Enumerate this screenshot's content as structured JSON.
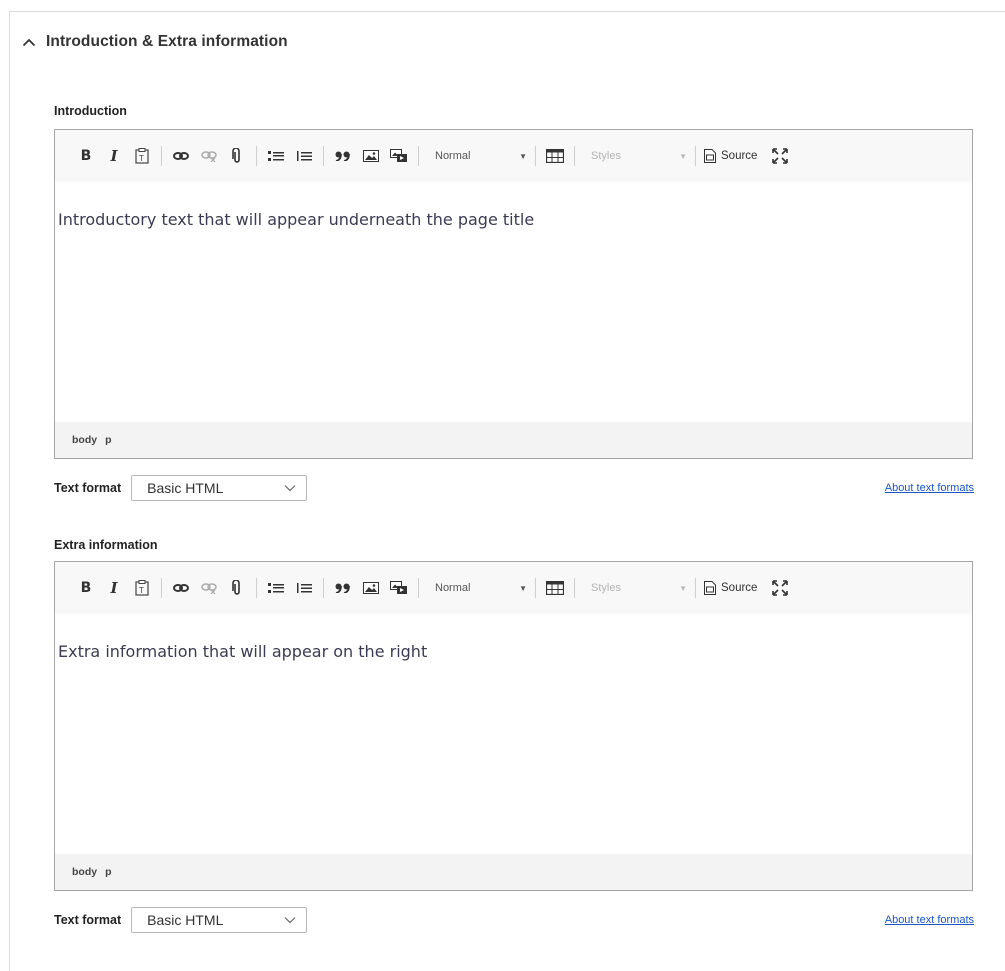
{
  "section": {
    "title": "Introduction & Extra information"
  },
  "toolbar": {
    "bold": "B",
    "italic": "I",
    "format_combo": "Normal",
    "styles_combo": "Styles",
    "source": "Source"
  },
  "editors": [
    {
      "label": "Introduction",
      "content": "Introductory text that will appear underneath the page title",
      "path": [
        "body",
        "p"
      ],
      "text_format_label": "Text format",
      "text_format_value": "Basic HTML",
      "about_link": "About text formats"
    },
    {
      "label": "Extra information",
      "content": "Extra information that will appear on the right",
      "path": [
        "body",
        "p"
      ],
      "text_format_label": "Text format",
      "text_format_value": "Basic HTML",
      "about_link": "About text formats"
    }
  ],
  "colors": {
    "link": "#1a56c5",
    "content_text": "#3b3b55",
    "toolbar_bg": "#f8f8f8",
    "statusbar_bg": "#f3f3f3"
  }
}
